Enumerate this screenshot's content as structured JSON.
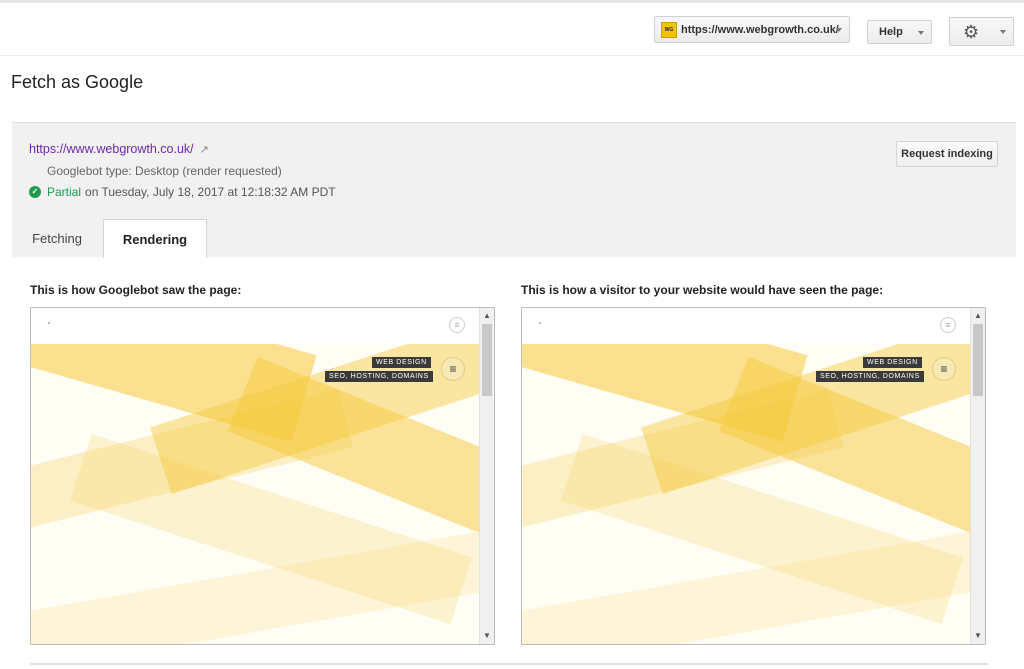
{
  "header": {
    "site_url": "https://www.webgrowth.co.uk/",
    "site_logo_text": "WG",
    "help_label": "Help"
  },
  "page": {
    "title": "Fetch as Google"
  },
  "fetch": {
    "url": "https://www.webgrowth.co.uk/",
    "bot_type": "Googlebot type: Desktop (render requested)",
    "status": "Partial",
    "status_detail": "on Tuesday, July 18, 2017 at 12:18:32 AM PDT",
    "request_indexing_label": "Request indexing"
  },
  "tabs": [
    {
      "label": "Fetching",
      "active": false
    },
    {
      "label": "Rendering",
      "active": true
    }
  ],
  "panels": {
    "googlebot_caption": "This is how Googlebot saw the page:",
    "visitor_caption": "This is how a visitor to your website would have seen the page:",
    "chip_primary": "WEB DESIGN",
    "chip_secondary": "SEO, HOSTING, DOMAINS"
  },
  "icons": {
    "external_link": "external-link-icon",
    "check": "check-circle-icon",
    "gear": "gear-icon",
    "menu": "hamburger-menu-icon"
  },
  "colors": {
    "link": "#6b2aa6",
    "success": "#1e9b4d",
    "panel_bg": "#f1f1f1",
    "hero_yellow": "#f5c93c"
  }
}
